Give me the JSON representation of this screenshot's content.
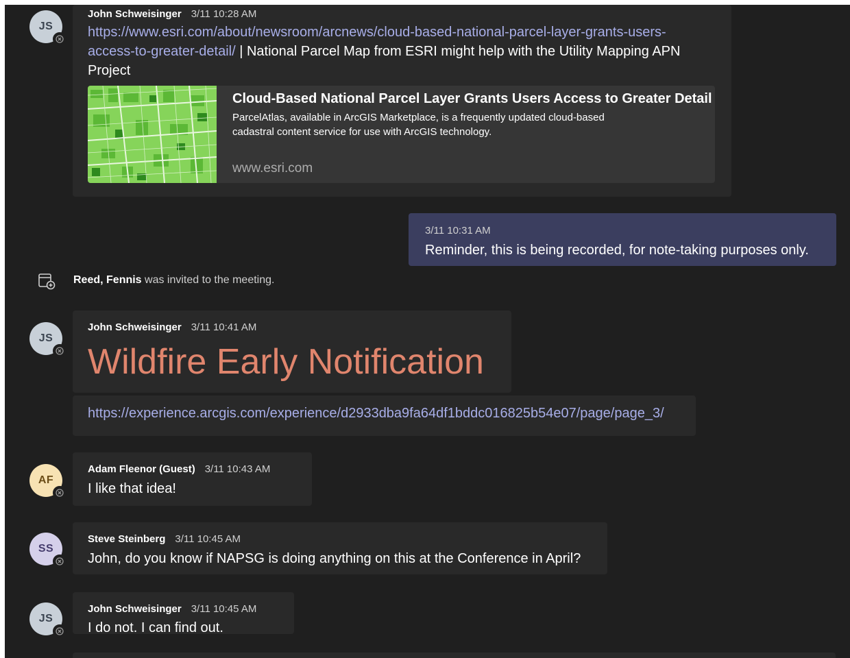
{
  "messages": {
    "m1": {
      "initials": "JS",
      "author": "John Schweisinger",
      "time": "3/11 10:28 AM",
      "link_line1": "https://www.esri.com/about/newsroom/arcnews/cloud-based-national-parcel-layer-grants-users-",
      "link_line2": "access-to-greater-detail/",
      "text_line2": " | National Parcel Map from ESRI might help with the Utility Mapping APN",
      "text_line3": "Project",
      "card": {
        "title": "Cloud-Based National Parcel Layer Grants Users Access to Greater Detail",
        "desc_line1": "ParcelAtlas, available in ArcGIS Marketplace, is a frequently updated cloud-based",
        "desc_line2": "cadastral content service for use with ArcGIS technology.",
        "domain": "www.esri.com"
      }
    },
    "m2": {
      "time": "3/11 10:31 AM",
      "text": "Reminder, this is being recorded, for note-taking purposes only."
    },
    "system": {
      "name": "Reed, Fennis",
      "text": " was invited to the meeting."
    },
    "m3": {
      "initials": "JS",
      "author": "John Schweisinger",
      "time": "3/11 10:41 AM",
      "headline": "Wildfire Early Notification",
      "link": "https://experience.arcgis.com/experience/d2933dba9fa64df1bddc016825b54e07/page/page_3/"
    },
    "m4": {
      "initials": "AF",
      "author": "Adam Fleenor (Guest)",
      "time": "3/11 10:43 AM",
      "text": "I like that idea!"
    },
    "m5": {
      "initials": "SS",
      "author": "Steve Steinberg",
      "time": "3/11 10:45 AM",
      "text": "John, do you know if NAPSG is doing anything on this at the Conference in April?"
    },
    "m6": {
      "initials": "JS",
      "author": "John Schweisinger",
      "time": "3/11 10:45 AM",
      "text": "I do not. I can find out."
    }
  },
  "colors": {
    "background": "#1f1f1f",
    "bubble": "#292929",
    "my_bubble": "#3b3e5f",
    "link": "#a8aee8",
    "headline": "#e0856d"
  },
  "icons": [
    "presence-status-icon",
    "meeting-invite-icon",
    "link-preview-thumbnail"
  ]
}
